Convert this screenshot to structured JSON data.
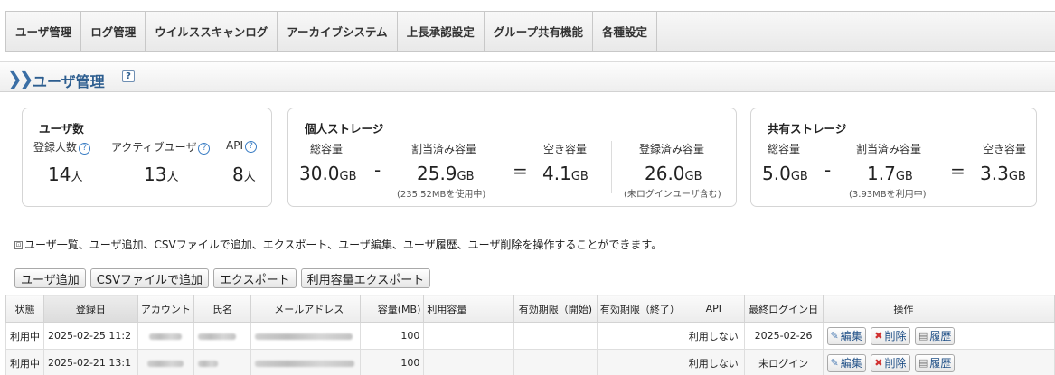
{
  "nav": {
    "tabs": [
      "ユーザ管理",
      "ログ管理",
      "ウイルススキャンログ",
      "アーカイブシステム",
      "上長承認設定",
      "グループ共有機能",
      "各種設定"
    ]
  },
  "header": {
    "title": "ユーザ管理",
    "help": "?"
  },
  "users_panel": {
    "title": "ユーザ数",
    "registered_label": "登録人数",
    "registered_value": "14",
    "registered_unit": "人",
    "active_label": "アクティブユーザ",
    "active_value": "13",
    "active_unit": "人",
    "api_label": "API",
    "api_value": "8",
    "api_unit": "人",
    "help": "?"
  },
  "personal_storage": {
    "title": "個人ストレージ",
    "total_label": "総容量",
    "total_value": "30.0",
    "total_unit": "GB",
    "assigned_label": "割当済み容量",
    "assigned_value": "25.9",
    "assigned_unit": "GB",
    "assigned_note": "(235.52MBを使用中)",
    "free_label": "空き容量",
    "free_value": "4.1",
    "free_unit": "GB",
    "registered_label": "登録済み容量",
    "registered_value": "26.0",
    "registered_unit": "GB",
    "registered_note": "(未ログインユーザ含む)",
    "minus": "-",
    "equals": "="
  },
  "shared_storage": {
    "title": "共有ストレージ",
    "total_label": "総容量",
    "total_value": "5.0",
    "total_unit": "GB",
    "assigned_label": "割当済み容量",
    "assigned_value": "1.7",
    "assigned_unit": "GB",
    "assigned_note": "(3.93MBを利用中)",
    "free_label": "空き容量",
    "free_value": "3.3",
    "free_unit": "GB",
    "minus": "-",
    "equals": "="
  },
  "info": {
    "icon": "⊡",
    "text": "ユーザ一覧、ユーザ追加、CSVファイルで追加、エクスポート、ユーザ編集、ユーザ履歴、ユーザ削除を操作することができます。"
  },
  "actions": {
    "add_user": "ユーザ追加",
    "csv_add": "CSVファイルで追加",
    "export": "エクスポート",
    "usage_export": "利用容量エクスポート"
  },
  "table": {
    "headers": [
      "状態",
      "登録日",
      "アカウント",
      "氏名",
      "メールアドレス",
      "容量(MB)",
      "利用容量",
      "有効期限（開始)",
      "有効期限（終了）",
      "API",
      "最終ログイン日",
      "操作"
    ],
    "rows": [
      {
        "status": "利用中",
        "registered": "2025-02-25 11:2",
        "capacity": "100",
        "api": "利用しない",
        "last_login": "2025-02-26"
      },
      {
        "status": "利用中",
        "registered": "2025-02-21 13:1",
        "capacity": "100",
        "api": "利用しない",
        "last_login": "未ログイン"
      }
    ],
    "op_edit": "編集",
    "op_delete": "削除",
    "op_history": "履歴"
  }
}
